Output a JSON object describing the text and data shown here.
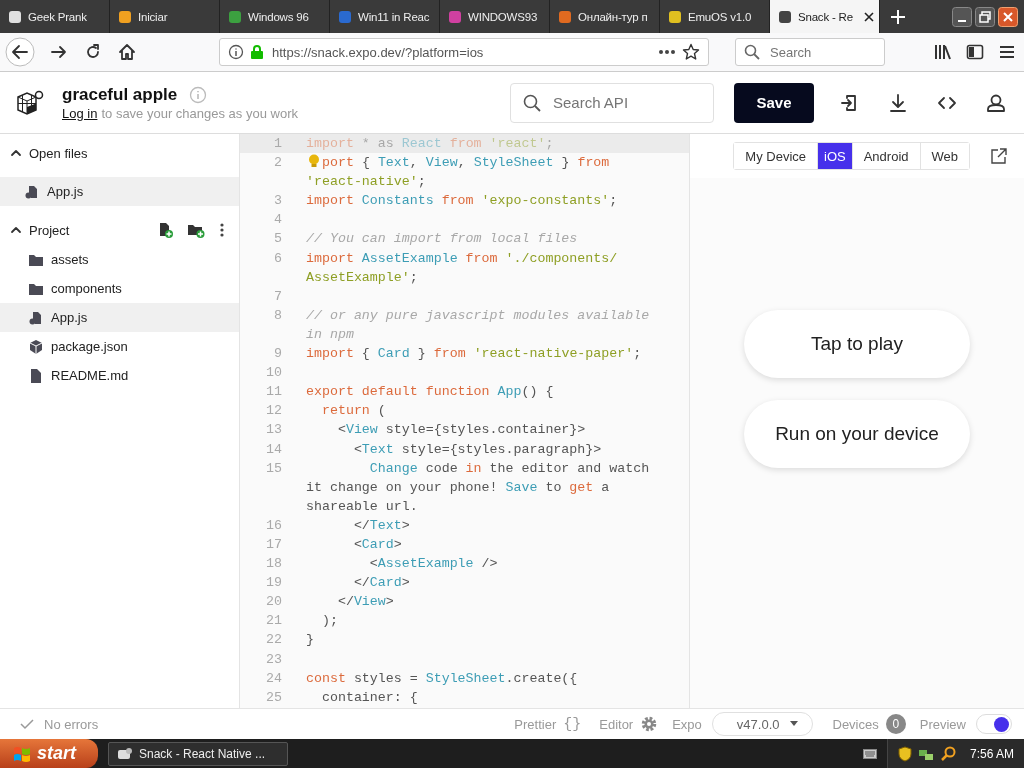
{
  "browser": {
    "tabs": [
      {
        "title": "Geek Prank",
        "selected": false
      },
      {
        "title": "Iniciar",
        "selected": false
      },
      {
        "title": "Windows 96",
        "selected": false
      },
      {
        "title": "Win11 in Reac",
        "selected": false
      },
      {
        "title": "WINDOWS93",
        "selected": false
      },
      {
        "title": "Онлайн-тур п",
        "selected": false
      },
      {
        "title": "EmuOS v1.0",
        "selected": false
      },
      {
        "title": "Snack - Re",
        "selected": true
      }
    ],
    "address": "https://snack.expo.dev/?platform=ios",
    "search_placeholder": "Search"
  },
  "header": {
    "title": "graceful apple",
    "login_link": "Log in",
    "login_text": "to save your changes as you work",
    "search_placeholder": "Search API",
    "save_button": "Save"
  },
  "sidebar": {
    "sections": [
      {
        "title": "Open files",
        "expanded": true,
        "actions": false,
        "items": [
          {
            "name": "App.js",
            "kind": "js",
            "selected": true
          }
        ]
      },
      {
        "title": "Project",
        "expanded": true,
        "actions": true,
        "items": [
          {
            "name": "assets",
            "kind": "folder",
            "selected": false
          },
          {
            "name": "components",
            "kind": "folder",
            "selected": false
          },
          {
            "name": "App.js",
            "kind": "js",
            "selected": true
          },
          {
            "name": "package.json",
            "kind": "package",
            "selected": false
          },
          {
            "name": "README.md",
            "kind": "file",
            "selected": false
          }
        ]
      }
    ]
  },
  "editor": {
    "lines": [
      {
        "number": "1",
        "active": true,
        "bulb": false,
        "rows": [
          {
            "tokens": [
              {
                "kind": "k",
                "text": "import"
              },
              {
                "kind": "p",
                "text": " * as "
              },
              {
                "kind": "t",
                "text": "React "
              },
              {
                "kind": "k",
                "text": "from "
              },
              {
                "kind": "s",
                "text": "'react'"
              },
              {
                "kind": "p",
                "text": ";"
              }
            ]
          }
        ]
      },
      {
        "number": "2",
        "active": false,
        "bulb": true,
        "rows": [
          {
            "tokens": [
              {
                "kind": "k",
                "text": "port"
              },
              {
                "kind": "p",
                "text": " { "
              },
              {
                "kind": "t",
                "text": "Text"
              },
              {
                "kind": "p",
                "text": ", "
              },
              {
                "kind": "t",
                "text": "View"
              },
              {
                "kind": "p",
                "text": ", "
              },
              {
                "kind": "t",
                "text": "StyleSheet"
              },
              {
                "kind": "p",
                "text": " } "
              },
              {
                "kind": "k",
                "text": "from"
              }
            ]
          },
          {
            "tokens": [
              {
                "kind": "s",
                "text": "'react-native'"
              },
              {
                "kind": "p",
                "text": ";"
              }
            ]
          }
        ]
      },
      {
        "number": "3",
        "active": false,
        "bulb": false,
        "rows": [
          {
            "tokens": [
              {
                "kind": "k",
                "text": "import "
              },
              {
                "kind": "t",
                "text": "Constants "
              },
              {
                "kind": "k",
                "text": "from "
              },
              {
                "kind": "s",
                "text": "'expo-constants'"
              },
              {
                "kind": "p",
                "text": ";"
              }
            ]
          }
        ]
      },
      {
        "number": "4",
        "active": false,
        "bulb": false
      },
      {
        "number": "5",
        "active": false,
        "bulb": false,
        "rows": [
          {
            "tokens": [
              {
                "kind": "c",
                "text": "// You can import from local files"
              }
            ]
          }
        ]
      },
      {
        "number": "6",
        "active": false,
        "bulb": false,
        "rows": [
          {
            "tokens": [
              {
                "kind": "k",
                "text": "import "
              },
              {
                "kind": "t",
                "text": "AssetExample "
              },
              {
                "kind": "k",
                "text": "from "
              },
              {
                "kind": "s",
                "text": "'./components/"
              }
            ]
          },
          {
            "tokens": [
              {
                "kind": "s",
                "text": "AssetExample'"
              },
              {
                "kind": "p",
                "text": ";"
              }
            ]
          }
        ]
      },
      {
        "number": "7",
        "active": false,
        "bulb": false
      },
      {
        "number": "8",
        "active": false,
        "bulb": false,
        "rows": [
          {
            "tokens": [
              {
                "kind": "c",
                "text": "// or any pure javascript modules available"
              }
            ]
          },
          {
            "tokens": [
              {
                "kind": "c",
                "text": "in npm"
              }
            ]
          }
        ]
      },
      {
        "number": "9",
        "active": false,
        "bulb": false,
        "rows": [
          {
            "tokens": [
              {
                "kind": "k",
                "text": "import"
              },
              {
                "kind": "p",
                "text": " { "
              },
              {
                "kind": "t",
                "text": "Card"
              },
              {
                "kind": "p",
                "text": " } "
              },
              {
                "kind": "k",
                "text": "from "
              },
              {
                "kind": "s",
                "text": "'react-native-paper'"
              },
              {
                "kind": "p",
                "text": ";"
              }
            ]
          }
        ]
      },
      {
        "number": "10",
        "active": false,
        "bulb": false
      },
      {
        "number": "11",
        "active": false,
        "bulb": false,
        "rows": [
          {
            "tokens": [
              {
                "kind": "k",
                "text": "export "
              },
              {
                "kind": "k",
                "text": "default "
              },
              {
                "kind": "k",
                "text": "function "
              },
              {
                "kind": "t",
                "text": "App"
              },
              {
                "kind": "p",
                "text": "() {"
              }
            ]
          }
        ]
      },
      {
        "number": "12",
        "active": false,
        "bulb": false,
        "rows": [
          {
            "tokens": [
              {
                "kind": "k",
                "text": "  return"
              },
              {
                "kind": "p",
                "text": " ("
              }
            ]
          }
        ]
      },
      {
        "number": "13",
        "active": false,
        "bulb": false,
        "rows": [
          {
            "tokens": [
              {
                "kind": "p",
                "text": "    <"
              },
              {
                "kind": "t",
                "text": "View"
              },
              {
                "kind": "p",
                "text": " style={styles.container}>"
              }
            ]
          }
        ]
      },
      {
        "number": "14",
        "active": false,
        "bulb": false,
        "rows": [
          {
            "tokens": [
              {
                "kind": "p",
                "text": "      <"
              },
              {
                "kind": "t",
                "text": "Text"
              },
              {
                "kind": "p",
                "text": " style={styles.paragraph}>"
              }
            ]
          }
        ]
      },
      {
        "number": "15",
        "active": false,
        "bulb": false,
        "rows": [
          {
            "tokens": [
              {
                "kind": "t",
                "text": "        Change"
              },
              {
                "kind": "p",
                "text": " code "
              },
              {
                "kind": "k",
                "text": "in"
              },
              {
                "kind": "p",
                "text": " the editor and watch"
              }
            ]
          },
          {
            "tokens": [
              {
                "kind": "p",
                "text": "it change on your phone! "
              },
              {
                "kind": "t",
                "text": "Save"
              },
              {
                "kind": "p",
                "text": " to "
              },
              {
                "kind": "k",
                "text": "get"
              },
              {
                "kind": "p",
                "text": " a"
              }
            ]
          },
          {
            "tokens": [
              {
                "kind": "p",
                "text": "shareable url."
              }
            ]
          }
        ]
      },
      {
        "number": "16",
        "active": false,
        "bulb": false,
        "rows": [
          {
            "tokens": [
              {
                "kind": "p",
                "text": "      </"
              },
              {
                "kind": "t",
                "text": "Text"
              },
              {
                "kind": "p",
                "text": ">"
              }
            ]
          }
        ]
      },
      {
        "number": "17",
        "active": false,
        "bulb": false,
        "rows": [
          {
            "tokens": [
              {
                "kind": "p",
                "text": "      <"
              },
              {
                "kind": "t",
                "text": "Card"
              },
              {
                "kind": "p",
                "text": ">"
              }
            ]
          }
        ]
      },
      {
        "number": "18",
        "active": false,
        "bulb": false,
        "rows": [
          {
            "tokens": [
              {
                "kind": "p",
                "text": "        <"
              },
              {
                "kind": "t",
                "text": "AssetExample"
              },
              {
                "kind": "p",
                "text": " />"
              }
            ]
          }
        ]
      },
      {
        "number": "19",
        "active": false,
        "bulb": false,
        "rows": [
          {
            "tokens": [
              {
                "kind": "p",
                "text": "      </"
              },
              {
                "kind": "t",
                "text": "Card"
              },
              {
                "kind": "p",
                "text": ">"
              }
            ]
          }
        ]
      },
      {
        "number": "20",
        "active": false,
        "bulb": false,
        "rows": [
          {
            "tokens": [
              {
                "kind": "p",
                "text": "    </"
              },
              {
                "kind": "t",
                "text": "View"
              },
              {
                "kind": "p",
                "text": ">"
              }
            ]
          }
        ]
      },
      {
        "number": "21",
        "active": false,
        "bulb": false,
        "rows": [
          {
            "tokens": [
              {
                "kind": "p",
                "text": "  );"
              }
            ]
          }
        ]
      },
      {
        "number": "22",
        "active": false,
        "bulb": false,
        "rows": [
          {
            "tokens": [
              {
                "kind": "p",
                "text": "}"
              }
            ]
          }
        ]
      },
      {
        "number": "23",
        "active": false,
        "bulb": false
      },
      {
        "number": "24",
        "active": false,
        "bulb": false,
        "rows": [
          {
            "tokens": [
              {
                "kind": "k",
                "text": "const"
              },
              {
                "kind": "p",
                "text": " styles = "
              },
              {
                "kind": "t",
                "text": "StyleSheet"
              },
              {
                "kind": "p",
                "text": ".create({"
              }
            ]
          }
        ]
      },
      {
        "number": "25",
        "active": false,
        "bulb": false,
        "rows": [
          {
            "tokens": [
              {
                "kind": "p",
                "text": "  container: {"
              }
            ]
          }
        ]
      }
    ]
  },
  "preview": {
    "platforms": [
      {
        "label": "My Device",
        "selected": false
      },
      {
        "label": "iOS",
        "selected": true
      },
      {
        "label": "Android",
        "selected": false
      },
      {
        "label": "Web",
        "selected": false
      }
    ],
    "buttons": [
      "Tap to play",
      "Run on your device"
    ]
  },
  "status_bar": {
    "errors": "No errors",
    "prettier": "Prettier",
    "prettier_icon": "{}",
    "editor": "Editor",
    "expo": "Expo",
    "version": "v47.0.0",
    "devices": "Devices",
    "device_count": "0",
    "preview": "Preview",
    "preview_on": true
  },
  "taskbar": {
    "start": "start",
    "tasks": [
      "Snack - React Native ..."
    ],
    "clock": "7:56 AM"
  }
}
